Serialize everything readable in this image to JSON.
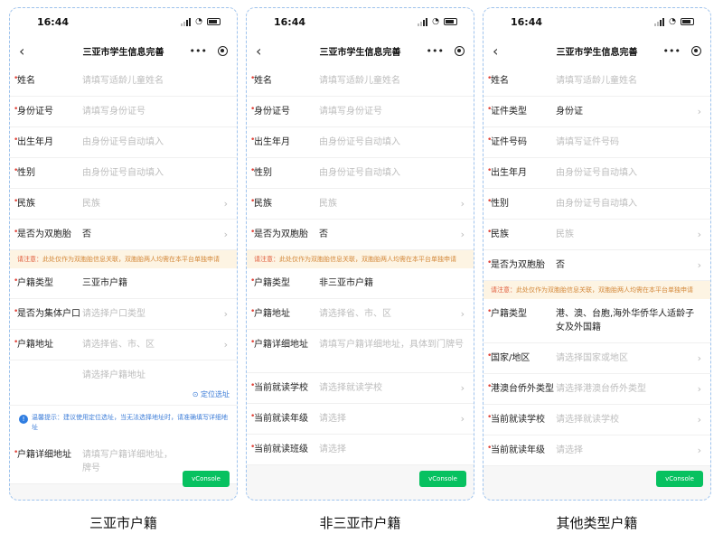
{
  "phones": [
    {
      "status_time": "16:44",
      "nav_title": "三亚市学生信息完善",
      "rows": [
        {
          "label": "姓名",
          "value": "请填写适龄儿童姓名",
          "filled": false,
          "chev": false
        },
        {
          "label": "身份证号",
          "value": "请填写身份证号",
          "filled": false,
          "chev": false
        },
        {
          "label": "出生年月",
          "value": "由身份证号自动填入",
          "filled": false,
          "chev": false
        },
        {
          "label": "性别",
          "value": "由身份证号自动填入",
          "filled": false,
          "chev": false
        },
        {
          "label": "民族",
          "value": "民族",
          "filled": false,
          "chev": true
        },
        {
          "label": "是否为双胞胎",
          "value": "否",
          "filled": true,
          "chev": true
        }
      ],
      "notice": {
        "prefix": "请注意：",
        "text": "此处仅作为双胞胎信息关联，双胞胎两人均需在本平台单独申请"
      },
      "rows2": [
        {
          "label": "户籍类型",
          "value": "三亚市户籍",
          "filled": true,
          "chev": false
        },
        {
          "label": "是否为集体户口",
          "value": "请选择户口类型",
          "filled": false,
          "chev": true
        },
        {
          "label": "户籍地址",
          "value": "请选择省、市、区",
          "filled": false,
          "chev": true
        }
      ],
      "detail_row": {
        "value": "请选择户籍地址",
        "link": "定位选址"
      },
      "tip": "温馨提示：建议使用定位选址，当无法选择地址时，请准确填写详细地址",
      "last_row": {
        "label": "户籍详细地址",
        "value": "请填写户籍详细地址，",
        "value2": "牌号"
      },
      "vconsole": "vConsole",
      "caption": "三亚市户籍"
    },
    {
      "status_time": "16:44",
      "nav_title": "三亚市学生信息完善",
      "rows": [
        {
          "label": "姓名",
          "value": "请填写适龄儿童姓名",
          "filled": false,
          "chev": false
        },
        {
          "label": "身份证号",
          "value": "请填写身份证号",
          "filled": false,
          "chev": false
        },
        {
          "label": "出生年月",
          "value": "由身份证号自动填入",
          "filled": false,
          "chev": false
        },
        {
          "label": "性别",
          "value": "由身份证号自动填入",
          "filled": false,
          "chev": false
        },
        {
          "label": "民族",
          "value": "民族",
          "filled": false,
          "chev": true
        },
        {
          "label": "是否为双胞胎",
          "value": "否",
          "filled": true,
          "chev": true
        }
      ],
      "notice": {
        "prefix": "请注意：",
        "text": "此处仅作为双胞胎信息关联，双胞胎两人均需在本平台单独申请"
      },
      "rows2": [
        {
          "label": "户籍类型",
          "value": "非三亚市户籍",
          "filled": true,
          "chev": false
        },
        {
          "label": "户籍地址",
          "value": "请选择省、市、区",
          "filled": false,
          "chev": true
        },
        {
          "label": "户籍详细地址",
          "value": "请填写户籍详细地址，具体到门牌号",
          "filled": false,
          "chev": false
        },
        {
          "label": "当前就读学校",
          "value": "请选择就读学校",
          "filled": false,
          "chev": true
        },
        {
          "label": "当前就读年级",
          "value": "请选择",
          "filled": false,
          "chev": true
        },
        {
          "label": "当前就读班级",
          "value": "请选择",
          "filled": false,
          "chev": false
        }
      ],
      "vconsole": "vConsole",
      "caption": "非三亚市户籍"
    },
    {
      "status_time": "16:44",
      "nav_title": "三亚市学生信息完善",
      "rows": [
        {
          "label": "姓名",
          "value": "请填写适龄儿童姓名",
          "filled": false,
          "chev": false
        },
        {
          "label": "证件类型",
          "value": "身份证",
          "filled": true,
          "chev": true
        },
        {
          "label": "证件号码",
          "value": "请填写证件号码",
          "filled": false,
          "chev": false
        },
        {
          "label": "出生年月",
          "value": "由身份证号自动填入",
          "filled": false,
          "chev": false
        },
        {
          "label": "性别",
          "value": "由身份证号自动填入",
          "filled": false,
          "chev": false
        },
        {
          "label": "民族",
          "value": "民族",
          "filled": false,
          "chev": true
        },
        {
          "label": "是否为双胞胎",
          "value": "否",
          "filled": true,
          "chev": true
        }
      ],
      "notice": {
        "prefix": "请注意：",
        "text": "此处仅作为双胞胎信息关联，双胞胎两人均需在本平台单独申请"
      },
      "rows2": [
        {
          "label": "户籍类型",
          "value": "港、澳、台胞,海外华侨华人适龄子女及外国籍",
          "filled": true,
          "chev": false
        },
        {
          "label": "国家/地区",
          "value": "请选择国家或地区",
          "filled": false,
          "chev": true
        },
        {
          "label": "港澳台侨外类型",
          "value": "请选择港澳台侨外类型",
          "filled": false,
          "chev": true
        },
        {
          "label": "当前就读学校",
          "value": "请选择就读学校",
          "filled": false,
          "chev": true
        },
        {
          "label": "当前就读年级",
          "value": "请选择",
          "filled": false,
          "chev": true
        }
      ],
      "vconsole": "vConsole",
      "caption": "其他类型户籍"
    }
  ]
}
